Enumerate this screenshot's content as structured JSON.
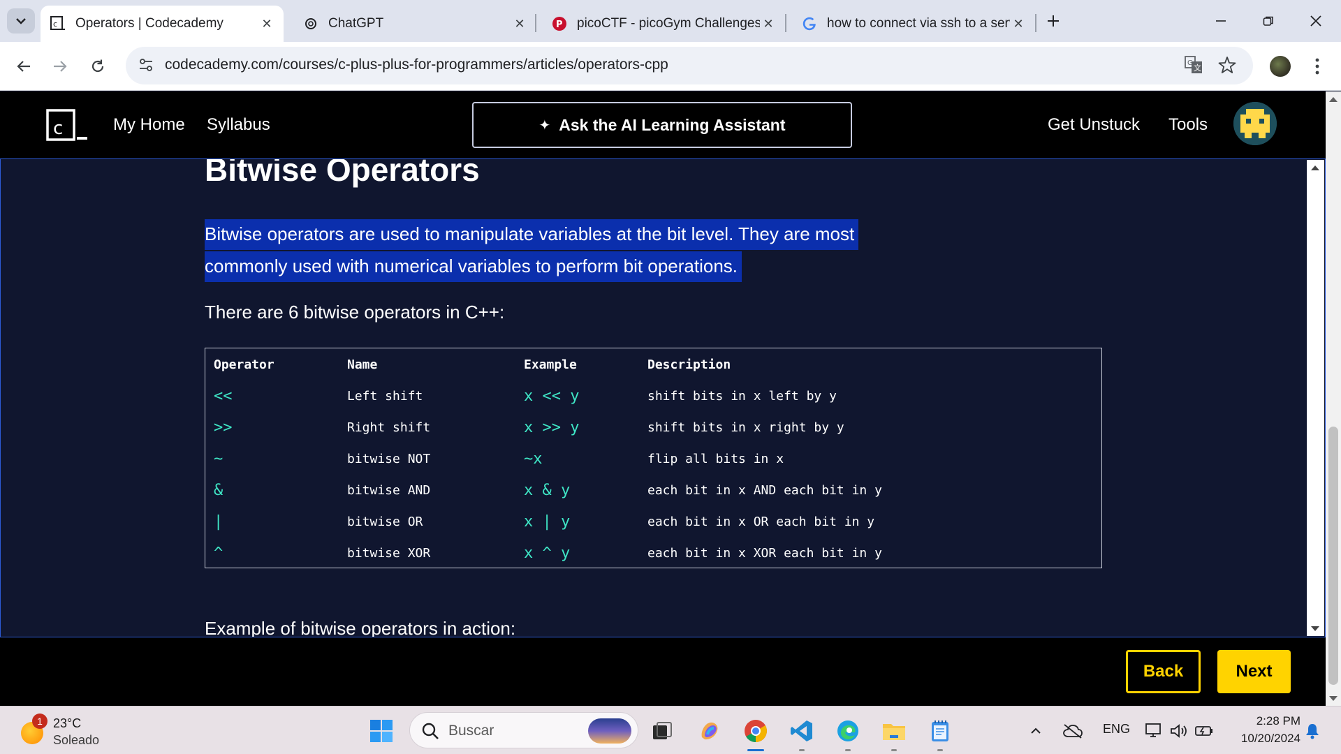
{
  "browser": {
    "tabs": [
      {
        "title": "Operators | Codecademy",
        "favicon": "codecademy-favicon",
        "active": true
      },
      {
        "title": "ChatGPT",
        "favicon": "openai-favicon",
        "active": false
      },
      {
        "title": "picoCTF - picoGym Challenges",
        "favicon": "picoctf-favicon",
        "active": false
      },
      {
        "title": "how to connect via ssh to a serv",
        "favicon": "google-favicon",
        "active": false
      }
    ],
    "url": "codecademy.com/courses/c-plus-plus-for-programmers/articles/operators-cpp"
  },
  "site_header": {
    "nav": {
      "home": "My Home",
      "syllabus": "Syllabus",
      "get_unstuck": "Get Unstuck",
      "tools": "Tools"
    },
    "ai_button": "Ask the AI Learning Assistant"
  },
  "article": {
    "heading": "Bitwise Operators",
    "intro_line1": "Bitwise operators are used to manipulate variables at the bit level. They are most",
    "intro_line2": "commonly used with numerical variables to perform bit operations.",
    "lead": "There are 6 bitwise operators in C++:",
    "table": {
      "headers": [
        "Operator",
        "Name",
        "Example",
        "Description"
      ],
      "rows": [
        [
          "<<",
          "Left shift",
          "x << y",
          "shift bits in x left by y"
        ],
        [
          ">>",
          "Right shift",
          "x >> y",
          "shift bits in x right by y"
        ],
        [
          "~",
          "bitwise NOT",
          "~x",
          "flip all bits in x"
        ],
        [
          "&",
          "bitwise AND",
          "x & y",
          "each bit in x AND each bit in y"
        ],
        [
          "|",
          "bitwise OR",
          "x | y",
          "each bit in x OR each bit in y"
        ],
        [
          "^",
          "bitwise XOR",
          "x ^ y",
          "each bit in x XOR each bit in y"
        ]
      ]
    },
    "example_lead": "Example of bitwise operators in action:"
  },
  "bottom_nav": {
    "back": "Back",
    "next": "Next"
  },
  "taskbar": {
    "weather": {
      "badge": "1",
      "temp": "23°C",
      "condition": "Soleado"
    },
    "search_placeholder": "Buscar",
    "language": "ENG",
    "time": "2:28 PM",
    "date": "10/20/2024"
  },
  "colors": {
    "accent_yellow": "#ffd300",
    "code_teal": "#3fe6c6",
    "selection_blue": "#0b2fad",
    "page_bg": "#10162f"
  }
}
